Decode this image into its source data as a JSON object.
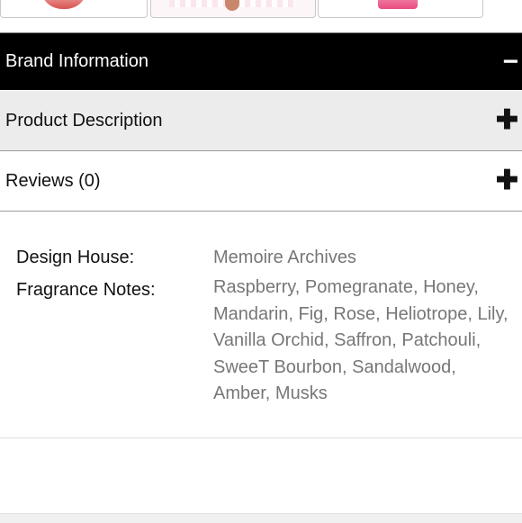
{
  "accordion": {
    "brand": {
      "label": "Brand Information",
      "sign": "−"
    },
    "description": {
      "label": "Product Description",
      "sign": "✚"
    },
    "reviews": {
      "label": "Reviews (0)",
      "sign": "✚"
    }
  },
  "brand_info": {
    "design_house_label": "Design House:",
    "design_house_value": "Memoire Archives",
    "notes_label": "Fragrance Notes:",
    "notes_value": "Raspberry, Pomegranate, Honey, Mandarin, Fig, Rose, Heliotrope, Lily, Vanilla Orchid, Saffron, Patchouli, SweeT Bourbon, Sandalwood, Amber, Musks"
  }
}
